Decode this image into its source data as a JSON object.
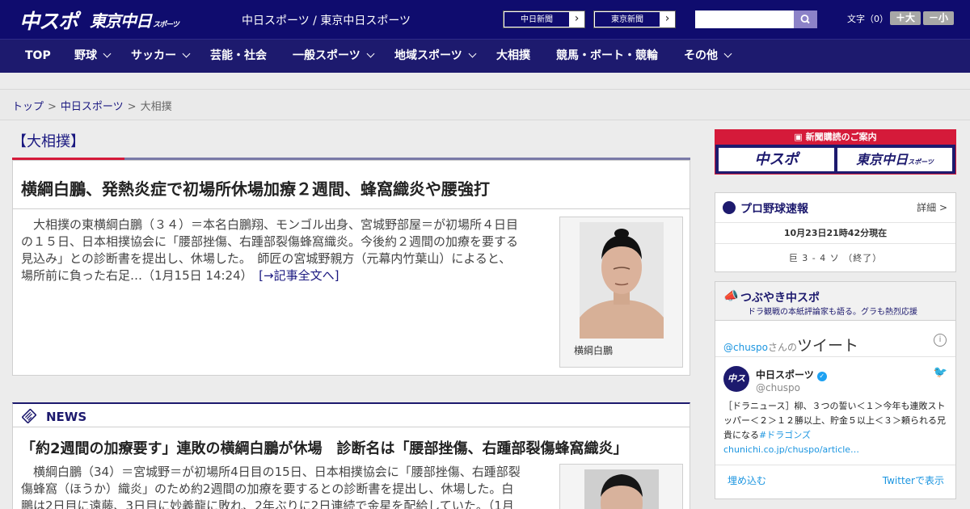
{
  "header": {
    "logo_chuspo": "中スポ",
    "logo_tokyo": "東京中日",
    "logo_tokyo_sub": "スポーツ",
    "site_title": "中日スポーツ / 東京中日スポーツ",
    "links": [
      {
        "label": "中日新聞",
        "arrow": "›"
      },
      {
        "label": "東京新聞",
        "arrow": "›"
      }
    ],
    "search_placeholder": "",
    "font_size_label": "文字（0）",
    "font_larger": "＋大",
    "font_smaller": "－小"
  },
  "nav": [
    {
      "label": "TOP"
    },
    {
      "label": "野球"
    },
    {
      "label": "サッカー"
    },
    {
      "label": "芸能・社会"
    },
    {
      "label": "一般スポーツ"
    },
    {
      "label": "地域スポーツ"
    },
    {
      "label": "大相撲"
    },
    {
      "label": "競馬・ボート・競輪"
    },
    {
      "label": "その他"
    }
  ],
  "breadcrumb": {
    "items": [
      "トップ",
      "中日スポーツ",
      "大相撲"
    ],
    "sep": ">"
  },
  "section": {
    "title": "【大相撲】"
  },
  "top_article": {
    "headline": "横綱白鵬、発熱炎症で初場所休場加療２週間、蜂窩織炎や腰強打",
    "body_lines": [
      "　大相撲の東横綱白鵬（３４）＝本名白鵬翔、モンゴル出身、宮城野部屋＝が初場所４日目",
      "の１５日、日本相撲協会に「腰部挫傷、右踵部裂傷蜂窩織炎。今後約２週間の加療を要する",
      "見込み」との診断書を提出し、休場した。　師匠の宮城野親方（元幕内竹葉山）によると、",
      "場所前に負った右足…（1月15日 14:24）"
    ],
    "more": "[→記事全文へ]",
    "caption": "横綱白鵬"
  },
  "news": {
    "label": "NEWS",
    "headline": "「約2週間の加療要す」連敗の横綱白鵬が休場　診断名は「腰部挫傷、右踵部裂傷蜂窩織炎」",
    "body_lines": [
      "　横綱白鵬（34）＝宮城野＝が初場所4日目の15日、日本相撲協会に「腰部挫傷、右踵部裂",
      "傷蜂窩（ほうか）織炎」のため約2週間の加療を要するとの診断書を提出し、休場した。白",
      "鵬は2日目に遠藤、3日目に妙義龍に敗れ、2年ぶりに2日連続で金星を配給していた。（1月"
    ]
  },
  "subscribe": {
    "title": "新聞購読のご案内",
    "logo_chuspo": "中スポ",
    "logo_tokyo": "東京中日",
    "logo_tokyo_sub": "スポーツ"
  },
  "baseball": {
    "title": "プロ野球速報",
    "detail": "詳細 >",
    "time": "10月23日21時42分現在",
    "score": "巨 3 - 4 ソ （終了）"
  },
  "twitter": {
    "title": "つぶやき中スポ",
    "subtitle": "ドラ観戦の本紙評論家も語る。グラも熱烈応援",
    "handle": "@chuspo",
    "handle_suffix": "さんの",
    "tweets_label": "ツイート",
    "avatar_text": "中スポ",
    "account_name": "中日スポーツ",
    "account_id": "@chuspo",
    "tweet_text": "［ドラニュース］柳、３つの誓い＜１＞今年も連敗ストッパー＜２＞１２勝以上、貯金５以上＜３＞頼られる兄貴になる",
    "tweet_tag": "#ドラゴンズ",
    "tweet_link": "chunichi.co.jp/chuspo/article…",
    "embed": "埋め込む",
    "view_on": "Twitterで表示"
  },
  "colors": {
    "navy": "#0f0c6e",
    "nav_bg": "#1d1a6e",
    "accent_red": "#d51a3a",
    "twitter_blue": "#1b95e0"
  }
}
